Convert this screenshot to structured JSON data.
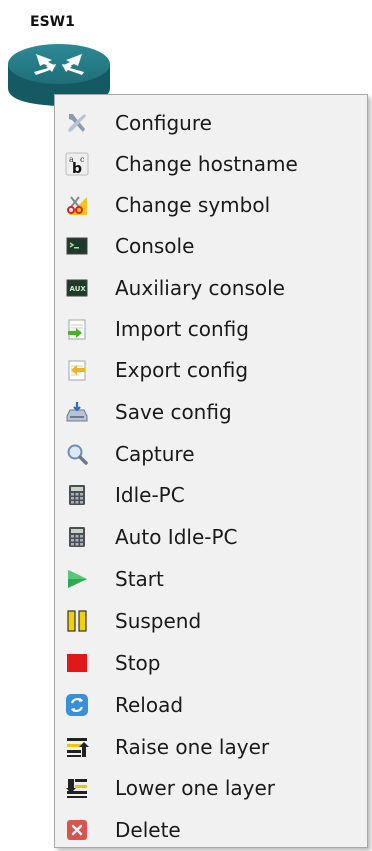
{
  "node": {
    "label": "ESW1",
    "icon": "ethernet-switch-router-icon"
  },
  "menu": {
    "items": [
      {
        "label": "Configure",
        "icon": "configure-tools-icon"
      },
      {
        "label": "Change hostname",
        "icon": "change-hostname-icon"
      },
      {
        "label": "Change symbol",
        "icon": "change-symbol-icon"
      },
      {
        "label": "Console",
        "icon": "console-terminal-icon"
      },
      {
        "label": "Auxiliary console",
        "icon": "aux-console-icon"
      },
      {
        "label": "Import config",
        "icon": "import-config-icon"
      },
      {
        "label": "Export config",
        "icon": "export-config-icon"
      },
      {
        "label": "Save config",
        "icon": "save-config-icon"
      },
      {
        "label": "Capture",
        "icon": "magnifier-icon"
      },
      {
        "label": "Idle-PC",
        "icon": "calculator-icon"
      },
      {
        "label": "Auto Idle-PC",
        "icon": "calculator-icon"
      },
      {
        "label": "Start",
        "icon": "play-icon"
      },
      {
        "label": "Suspend",
        "icon": "pause-icon"
      },
      {
        "label": "Stop",
        "icon": "stop-icon"
      },
      {
        "label": "Reload",
        "icon": "reload-icon"
      },
      {
        "label": "Raise one layer",
        "icon": "raise-layer-icon"
      },
      {
        "label": "Lower one layer",
        "icon": "lower-layer-icon"
      },
      {
        "label": "Delete",
        "icon": "delete-icon"
      }
    ]
  },
  "colors": {
    "menu_bg": "#f1f1f1",
    "router": "#1f6e78",
    "start": "#2fa84f",
    "suspend": "#f2d100",
    "stop": "#e01818",
    "delete": "#d9534f"
  }
}
